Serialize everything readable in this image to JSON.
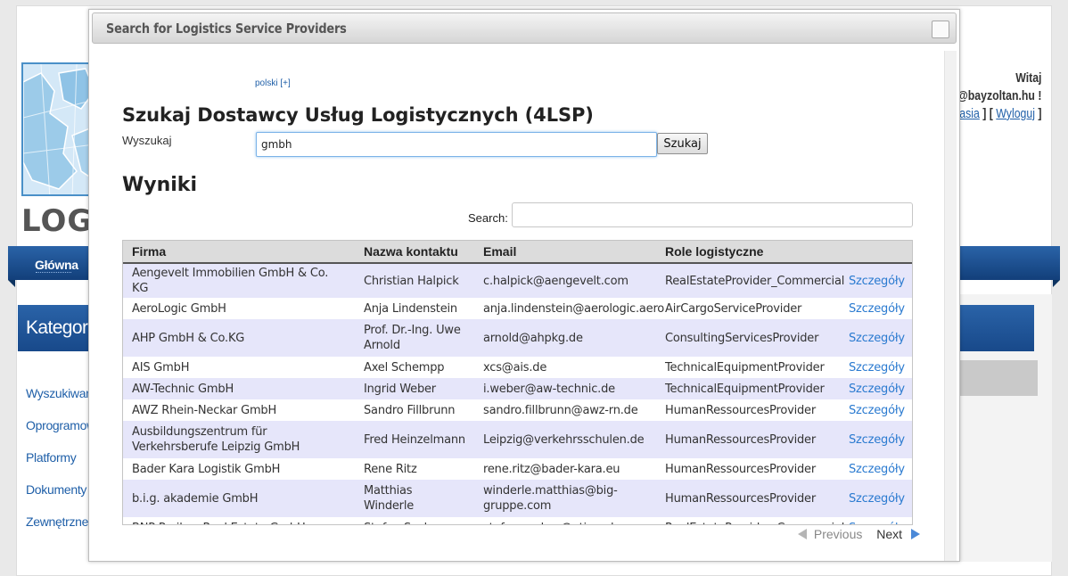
{
  "background": {
    "logo_text": "LOGI",
    "nav_home": "Główna",
    "user_greeting": "Witaj",
    "user_email": "@bayzoltan.hu !",
    "user_link_1": "asia",
    "user_link_2": "Wyloguj",
    "category_header": "Kategorie",
    "side_links": [
      "Wyszukiwan",
      "Oprogramow",
      "Platformy",
      "Dokumenty l",
      "Zewnętrzne"
    ]
  },
  "dialog": {
    "title": "Search for Logistics Service Providers",
    "language_link": "polski [+]",
    "heading": "Szukaj Dostawcy Usług Logistycznych (4LSP)",
    "search_label": "Wyszukaj",
    "search_value": "gmbh",
    "search_button": "Szukaj",
    "results_heading": "Wyniki",
    "filter_label": "Search:",
    "filter_value": ""
  },
  "table": {
    "columns": [
      "Firma",
      "Nazwa kontaktu",
      "Email",
      "Role logistyczne",
      ""
    ],
    "rows": [
      {
        "firma": "Aengevelt Immobilien GmbH & Co. KG",
        "kontakt": "Christian Halpick",
        "email": "c.halpick@aengevelt.com",
        "rola": "RealEstateProvider_Commercial",
        "link": "Szczegóły"
      },
      {
        "firma": "AeroLogic GmbH",
        "kontakt": "Anja Lindenstein",
        "email": "anja.lindenstein@aerologic.aero",
        "rola": "AirCargoServiceProvider",
        "link": "Szczegóły"
      },
      {
        "firma": "AHP GmbH & Co.KG",
        "kontakt": "Prof. Dr.-Ing. Uwe Arnold",
        "email": "arnold@ahpkg.de",
        "rola": "ConsultingServicesProvider",
        "link": "Szczegóły"
      },
      {
        "firma": "AIS GmbH",
        "kontakt": "Axel Schempp",
        "email": "xcs@ais.de",
        "rola": "TechnicalEquipmentProvider",
        "link": "Szczegóły"
      },
      {
        "firma": "AW-Technic GmbH",
        "kontakt": "Ingrid Weber",
        "email": "i.weber@aw-technic.de",
        "rola": "TechnicalEquipmentProvider",
        "link": "Szczegóły"
      },
      {
        "firma": "AWZ Rhein-Neckar GmbH",
        "kontakt": "Sandro Fillbrunn",
        "email": "sandro.fillbrunn@awz-rn.de",
        "rola": "HumanRessourcesProvider",
        "link": "Szczegóły"
      },
      {
        "firma": "Ausbildungszentrum für Verkehrsberufe Leipzig GmbH",
        "kontakt": "Fred Heinzelmann",
        "email": "Leipzig@verkehrsschulen.de",
        "rola": "HumanRessourcesProvider",
        "link": "Szczegóły"
      },
      {
        "firma": "Bader Kara Logistik GmbH",
        "kontakt": "Rene Ritz",
        "email": "rene.ritz@bader-kara.eu",
        "rola": "HumanRessourcesProvider",
        "link": "Szczegóły"
      },
      {
        "firma": "b.i.g. akademie GmbH",
        "kontakt": "Matthias Winderle",
        "email": "winderle.matthias@big-gruppe.com",
        "rola": "HumanRessourcesProvider",
        "link": "Szczegóły"
      },
      {
        "firma": "BNP Paribas Real Estate GmbH",
        "kontakt": "Stefan Sachse",
        "email": "stefan.sachse@atisreal.com",
        "rola": "RealEstateProvider_Commercial",
        "link": "Szczegóły"
      }
    ]
  },
  "pager": {
    "previous": "Previous",
    "next": "Next"
  }
}
